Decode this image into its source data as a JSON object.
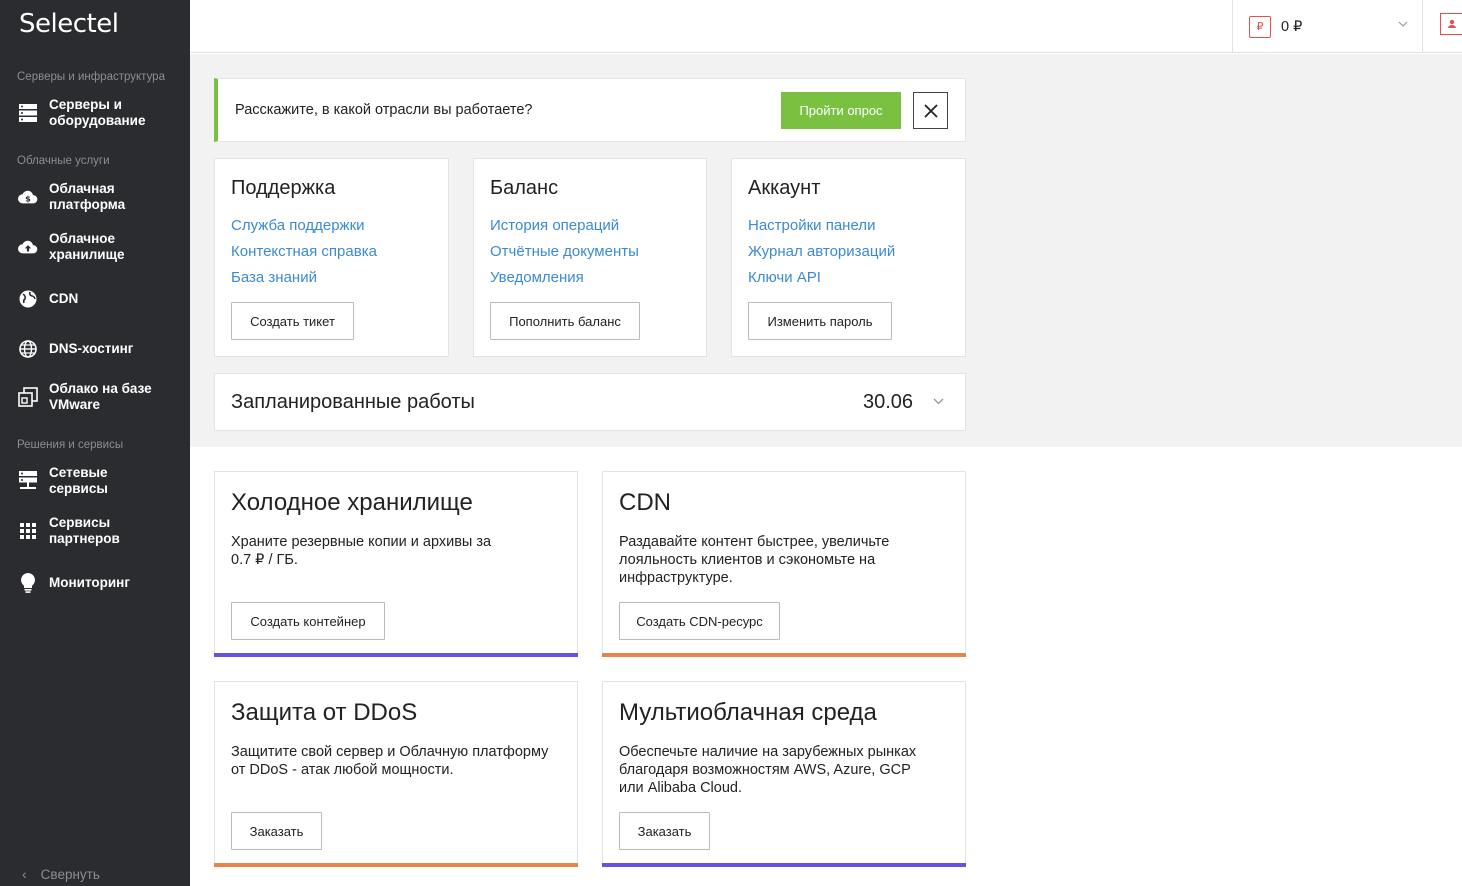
{
  "brand": {
    "logo": "Selectel"
  },
  "sidebar": {
    "sections": [
      "Серверы и инфраструктура",
      "Облачные услуги",
      "Решения и сервисы"
    ],
    "items": [
      {
        "label": "Серверы и\nоборудование",
        "icon": "server-icon"
      },
      {
        "label": "Облачная\nплатформа",
        "icon": "cloud-dollar-icon"
      },
      {
        "label": "Облачное\nхранилище",
        "icon": "cloud-upload-icon"
      },
      {
        "label": "CDN",
        "icon": "globe-filled-icon"
      },
      {
        "label": "DNS-хостинг",
        "icon": "globe-icon"
      },
      {
        "label": "Облако на базе\nVMware",
        "icon": "vmware-icon"
      },
      {
        "label": "Сетевые\nсервисы",
        "icon": "network-icon"
      },
      {
        "label": "Сервисы\nпартнеров",
        "icon": "grid-icon"
      },
      {
        "label": "Мониторинг",
        "icon": "bulb-icon"
      }
    ],
    "collapse_label": "Свернуть"
  },
  "topbar": {
    "currency_symbol": "₽",
    "balance": "0 ₽"
  },
  "survey": {
    "text": "Расскажите, в какой отрасли вы работаете?",
    "button": "Пройти опрос",
    "accent": "#7ac142"
  },
  "cards": [
    {
      "title": "Поддержка",
      "links": [
        "Служба поддержки",
        "Контекстная справка",
        "База знаний"
      ],
      "button": "Создать тикет"
    },
    {
      "title": "Баланс",
      "links": [
        "История операций",
        "Отчётные документы",
        "Уведомления"
      ],
      "button": "Пополнить баланс"
    },
    {
      "title": "Аккаунт",
      "links": [
        "Настройки панели",
        "Журнал авторизаций",
        "Ключи API"
      ],
      "button": "Изменить пароль"
    }
  ],
  "planned": {
    "title": "Запланированные работы",
    "date": "30.06"
  },
  "promos": [
    {
      "title": "Холодное хранилище",
      "desc": "Храните резервные копии и архивы за 0.7 ₽ / ГБ.",
      "button": "Создать контейнер",
      "accent": "#6b4fe0"
    },
    {
      "title": "CDN",
      "desc": "Раздавайте контент быстрее, увеличьте лояльность клиентов и сэкономьте на инфраструктуре.",
      "button": "Создать CDN-ресурс",
      "accent": "#e8834a"
    },
    {
      "title": "Защита от DDoS",
      "desc": "Защитите свой сервер и Облачную платформу от DDoS - атак любой мощности.",
      "button": "Заказать",
      "accent": "#e8834a"
    },
    {
      "title": "Мультиоблачная среда",
      "desc": "Обеспечьте наличие на зарубежных рынках благодаря возможностям AWS, Azure, GCP или Alibaba Cloud.",
      "button": "Заказать",
      "accent": "#6b4fe0"
    }
  ]
}
